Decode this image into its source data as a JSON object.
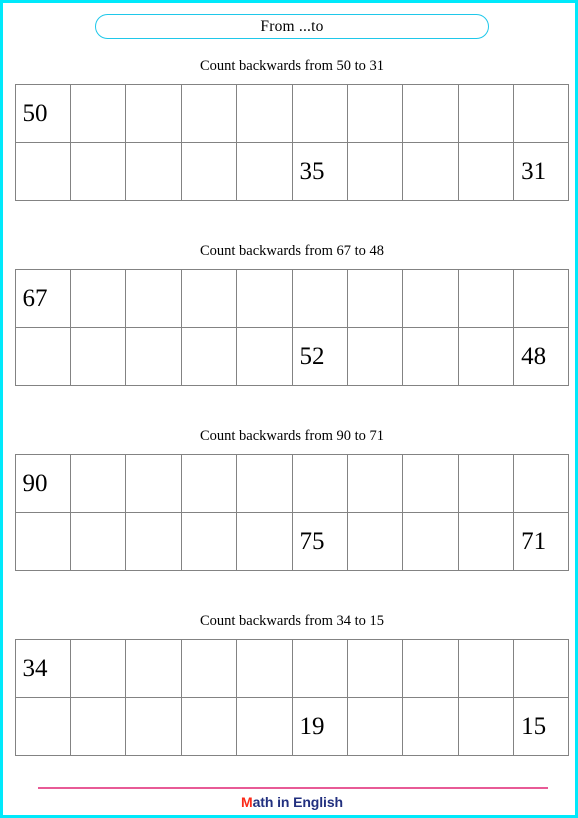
{
  "page": {
    "border_color": "#00e9fb",
    "background": "#ffffff"
  },
  "header": {
    "title": "From ...to",
    "box_border_color": "#1fc8ea"
  },
  "exercises": [
    {
      "title": "Count backwards from 50 to 31",
      "columns": 10,
      "rows": 2,
      "cells": {
        "row1": [
          "50",
          "",
          "",
          "",
          "",
          "",
          "",
          "",
          "",
          ""
        ],
        "row2": [
          "",
          "",
          "",
          "",
          "",
          "35",
          "",
          "",
          "",
          "31"
        ]
      }
    },
    {
      "title": "Count backwards from 67 to 48",
      "columns": 10,
      "rows": 2,
      "cells": {
        "row1": [
          "67",
          "",
          "",
          "",
          "",
          "",
          "",
          "",
          "",
          ""
        ],
        "row2": [
          "",
          "",
          "",
          "",
          "",
          "52",
          "",
          "",
          "",
          "48"
        ]
      }
    },
    {
      "title": "Count backwards from 90 to 71",
      "columns": 10,
      "rows": 2,
      "cells": {
        "row1": [
          "90",
          "",
          "",
          "",
          "",
          "",
          "",
          "",
          "",
          ""
        ],
        "row2": [
          "",
          "",
          "",
          "",
          "",
          "75",
          "",
          "",
          "",
          "71"
        ]
      }
    },
    {
      "title": "Count backwards from 34 to 15",
      "columns": 10,
      "rows": 2,
      "cells": {
        "row1": [
          "34",
          "",
          "",
          "",
          "",
          "",
          "",
          "",
          "",
          ""
        ],
        "row2": [
          "",
          "",
          "",
          "",
          "",
          "19",
          "",
          "",
          "",
          "15"
        ]
      }
    }
  ],
  "footer": {
    "rule_color": "#e85a96",
    "logo_initial": "M",
    "logo_rest": "ath in English",
    "logo_initial_color": "#fb2a18",
    "logo_rest_color": "#22307f"
  }
}
